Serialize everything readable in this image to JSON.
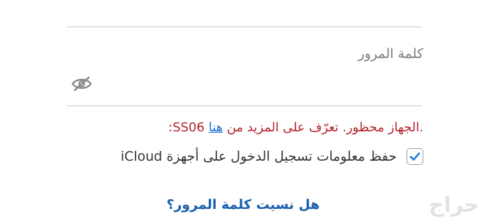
{
  "password_field": {
    "label": "كلمة المرور",
    "value": "",
    "visibility_icon": "eye-slash-icon"
  },
  "error": {
    "code": "SS06:",
    "prefix": ".الجهاز محظور. تعرّف على المزيد من",
    "link_text": "هنا",
    "color": "#b5232d",
    "link_color": "#1d6fd6"
  },
  "remember": {
    "checked": true,
    "label": "حفظ معلومات تسجيل الدخول على أجهزة iCloud",
    "check_color": "#1f7ed6"
  },
  "forgot_link": "هل نسيت كلمة المرور؟",
  "watermark": "حراج",
  "colors": {
    "link": "#1a5fae",
    "divider": "#c9c9c9"
  }
}
